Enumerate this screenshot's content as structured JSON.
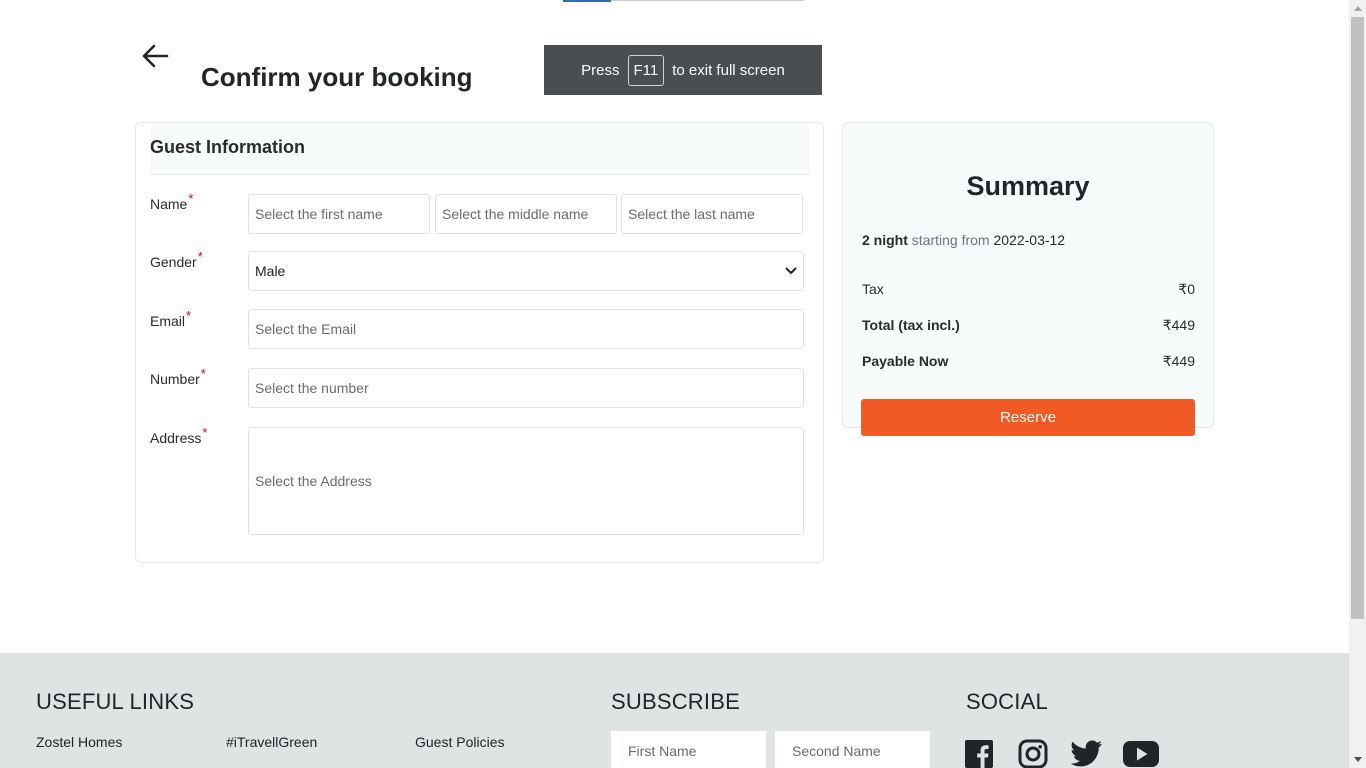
{
  "page": {
    "title": "Confirm your booking"
  },
  "fullscreen_toast": {
    "before": "Press",
    "key": "F11",
    "after": "to exit full screen"
  },
  "guest": {
    "title": "Guest Information",
    "required_mark": "*",
    "name_label": "Name",
    "first_placeholder": "Select the first name",
    "middle_placeholder": "Select the middle name",
    "last_placeholder": "Select the last name",
    "gender_label": "Gender",
    "gender_value": "Male",
    "email_label": "Email",
    "email_placeholder": "Select the Email",
    "number_label": "Number",
    "number_placeholder": "Select the number",
    "address_label": "Address",
    "address_placeholder": "Select the Address"
  },
  "summary": {
    "title": "Summary",
    "nights": "2 night",
    "starting_from": "starting from",
    "start_date": "2022-03-12",
    "rows": [
      {
        "label": "Tax",
        "value": "₹0"
      },
      {
        "label": "Total (tax incl.)",
        "value": "₹449"
      },
      {
        "label": "Payable Now",
        "value": "₹449"
      }
    ],
    "reserve_label": "Reserve",
    "reserve_color": "#f15a24"
  },
  "footer": {
    "useful_links_heading": "USEFUL LINKS",
    "links": [
      "Zostel Homes",
      "#iTravellGreen",
      "Guest Policies"
    ],
    "subscribe_heading": "SUBSCRIBE",
    "first_name_placeholder": "First Name",
    "second_name_placeholder": "Second Name",
    "social_heading": "SOCIAL",
    "social_icons": [
      "facebook-icon",
      "instagram-icon",
      "twitter-icon",
      "youtube-icon"
    ]
  }
}
